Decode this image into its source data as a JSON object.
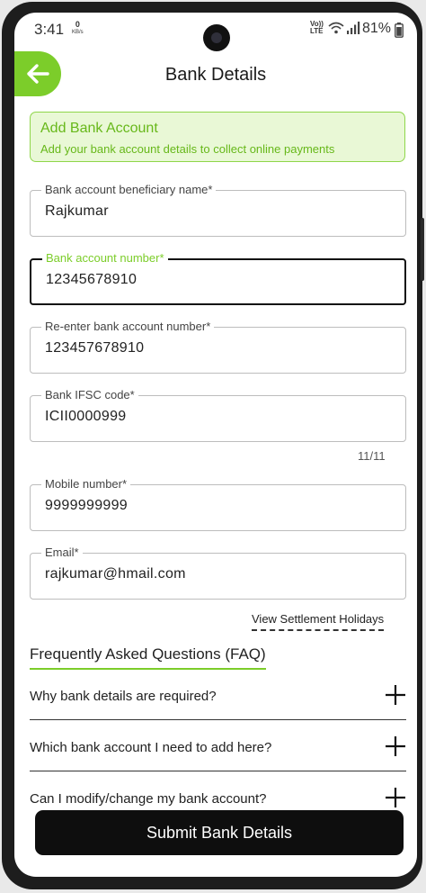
{
  "status_bar": {
    "time": "3:41",
    "data_speed_value": "0",
    "data_speed_unit": "KB/s",
    "network_label_1": "Vo))",
    "network_label_2": "LTE",
    "battery_percent": "81%"
  },
  "header": {
    "title": "Bank Details",
    "back_icon": "arrow-left-icon"
  },
  "banner": {
    "title": "Add Bank Account",
    "subtitle": "Add your bank account details to collect online payments"
  },
  "fields": [
    {
      "label": "Bank account beneficiary name*",
      "value": "Rajkumar"
    },
    {
      "label": "Bank account number*",
      "value": "12345678910"
    },
    {
      "label": "Re-enter bank account number*",
      "value": "123457678910"
    },
    {
      "label": "Bank IFSC code*",
      "value": "ICII0000999"
    },
    {
      "label": "Mobile number*",
      "value": "9999999999"
    },
    {
      "label": "Email*",
      "value": "rajkumar@hmail.com"
    }
  ],
  "ifsc_counter": "11/11",
  "view_settlement_link": "View Settlement Holidays",
  "faq": {
    "heading": "Frequently Asked Questions (FAQ)",
    "items": [
      {
        "question": "Why bank details are required?"
      },
      {
        "question": "Which bank account I need to add here?"
      },
      {
        "question": "Can I modify/change my bank account?"
      }
    ]
  },
  "submit_label": "Submit Bank Details",
  "colors": {
    "accent": "#7ccd2a",
    "banner_bg": "#e9f8d6",
    "banner_text": "#67b81a",
    "button_bg": "#0e0e0e"
  }
}
